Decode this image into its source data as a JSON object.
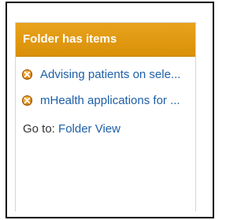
{
  "widget": {
    "title": "Folder has items",
    "items": [
      {
        "label": "Advising patients on sele..."
      },
      {
        "label": "mHealth applications for ..."
      }
    ],
    "goto_label": "Go to:",
    "goto_link": "Folder View"
  },
  "colors": {
    "header": "#e09a12",
    "link": "#1d5fa8",
    "icon": "#d9820b"
  },
  "icons": {
    "item_icon": "remove-x-icon"
  }
}
